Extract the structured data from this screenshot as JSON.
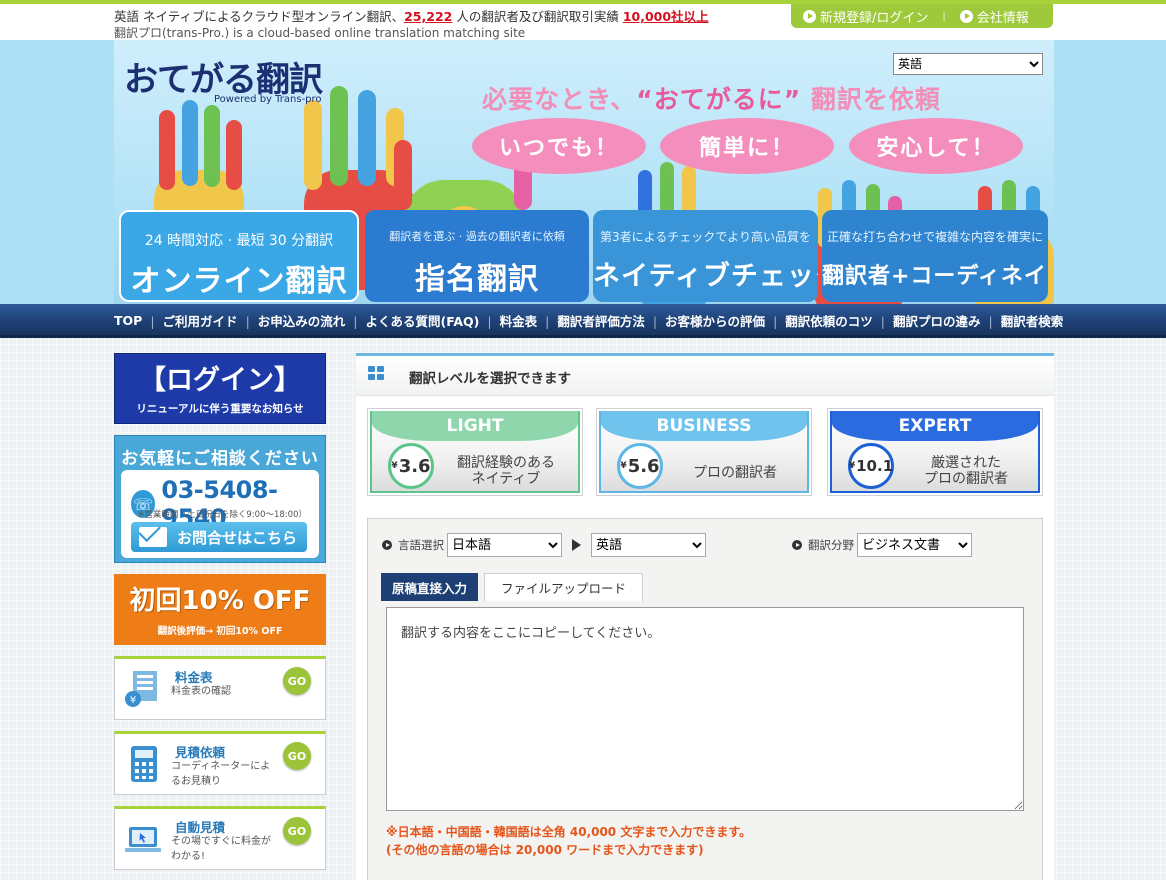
{
  "topbar": {
    "line1_pre": "英語 ネイティブによるクラウド型オンライン翻訳、",
    "translators_count": "25,222",
    "line1_mid": " 人の翻訳者及び翻訳取引実績 ",
    "companies_count": "10,000社以上",
    "line2": "翻訳プロ(trans-Pro.) is a cloud-based online translation matching site",
    "register_login": "新規登録/ログイン",
    "company_info": "会社情報"
  },
  "hero": {
    "logo_text": "おてがる翻訳",
    "logo_sub": "Powered by Trans-pro",
    "language_select": "英語",
    "catch_pre": "必要なとき、",
    "catch_quote": "“おてがるに”",
    "catch_post": " 翻訳を依頼",
    "pills": [
      "いつでも！",
      "簡単に！",
      "安心して！"
    ],
    "services": [
      {
        "small": "24 時間対応 · 最短 30 分翻訳",
        "large": "オンライン翻訳"
      },
      {
        "small": "翻訳者を選ぶ · 過去の翻訳者に依頼",
        "large": "指名翻訳"
      },
      {
        "small": "第3者によるチェックでより高い品質を",
        "large": "ネイティブチェック"
      },
      {
        "small": "正確な打ち合わせで複雑な内容を確実に",
        "large": "翻訳者+コーディネイト"
      }
    ]
  },
  "nav": [
    "TOP",
    "ご利用ガイド",
    "お申込みの流れ",
    "よくある質問(FAQ)",
    "料金表",
    "翻訳者評価方法",
    "お客様からの評価",
    "翻訳依頼のコツ",
    "翻訳プロの違み",
    "翻訳者検索"
  ],
  "sidebar": {
    "login_title": "【ログイン】",
    "login_sub": "リニューアルに伴う重要なお知らせ",
    "contact_heading": "お気軽にご相談ください",
    "phone": "03-5408-9540",
    "hours": "※営業時間（土日祝日を除く9:00～18:00）",
    "contact_button": "お問合せはこちら",
    "offer_title": "初回10% OFF",
    "offer_sub": "翻訳後評価→ 初回10% OFF",
    "go_label": "GO",
    "boxes": [
      {
        "title": "料金表",
        "desc": "料金表の確認"
      },
      {
        "title": "見積依頼",
        "desc": "コーディネーターによるお見積り"
      },
      {
        "title": "自動見積",
        "desc": "その場ですぐに料金がわかる!"
      }
    ]
  },
  "main": {
    "heading": "翻訳レベルを選択できます",
    "levels": [
      {
        "name": "LIGHT",
        "price": "3.6",
        "desc_line1": "翻訳経験のある",
        "desc_line2": "ネイティブ",
        "color": "#5cc68a",
        "tab": "#8fd6ac"
      },
      {
        "name": "BUSINESS",
        "price": "5.6",
        "desc_line1": "プロの翻訳者",
        "desc_line2": "",
        "color": "#5db7e6",
        "tab": "#6fc3ec"
      },
      {
        "name": "EXPERT",
        "price": "10.1",
        "desc_line1": "厳選された",
        "desc_line2": "プロの翻訳者",
        "color": "#1d5fd6",
        "tab": "#2a6be0"
      }
    ],
    "yen": "¥",
    "lang_label": "言語選択",
    "source_lang": "日本語",
    "target_lang": "英語",
    "field_label": "翻訳分野",
    "field_value": "ビジネス文書",
    "tab_direct": "原稿直接入力",
    "tab_upload": "ファイルアップロード",
    "textarea_placeholder": "翻訳する内容をここにコピーしてください。",
    "note_line1": "※日本語・中国語・韓国語は全角 40,000 文字まで入力できます。",
    "note_line2": "(その他の言語の場合は 20,000 ワードまで入力できます)"
  }
}
